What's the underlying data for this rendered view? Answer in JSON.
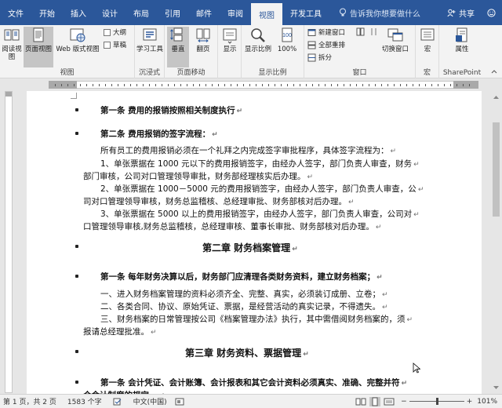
{
  "tabs": [
    "文件",
    "开始",
    "插入",
    "设计",
    "布局",
    "引用",
    "邮件",
    "审阅",
    "视图",
    "开发工具"
  ],
  "active_tab": "视图",
  "tell_me": "告诉我你想要做什么",
  "share": "共享",
  "ribbon": {
    "views": {
      "read_mode": "阅读视图",
      "print_layout": "页面视图",
      "web_layout": "Web 版式视图",
      "outline": "大纲",
      "draft": "草稿",
      "label": "视图"
    },
    "immersive": {
      "learning_tools": "学习工具",
      "label": "沉浸式"
    },
    "page_movement": {
      "vertical": "垂直",
      "side_to_side": "翻页",
      "label": "页面移动"
    },
    "show": {
      "show": "显示"
    },
    "zoom": {
      "zoom": "显示比例",
      "percent": "100%",
      "label": "显示比例"
    },
    "window": {
      "new_window": "新建窗口",
      "arrange_all": "全部重排",
      "split": "拆分",
      "switch_windows": "切换窗口",
      "label": "窗口"
    },
    "macros": {
      "macros": "宏",
      "label": "宏"
    },
    "sharepoint": {
      "properties": "属性",
      "label": "SharePoint"
    }
  },
  "document": {
    "lines": [
      {
        "text": "第一条  费用的报销按照相关制度执行",
        "bold": true,
        "bullet": true
      },
      {
        "text": "第二条  费用报销的签字流程：",
        "bold": true,
        "bullet": true
      },
      {
        "text": "所有员工的费用报销必须在一个礼拜之内完成签字审批程序，具体签字流程为："
      },
      {
        "text": "1、单张票据在 1000 元以下的费用报销签字，由经办人签字，部门负责人审查，财务"
      },
      {
        "text": "部门审核，公司对口管理领导审批，财务部经理核实后办理。"
      },
      {
        "text": "2、单张票据在 1000－5000 元的费用报销签字，由经办人签字，部门负责人审查，公"
      },
      {
        "text": "司对口管理领导审核，财务总监稽核、总经理审批、财务部核对后办理。"
      },
      {
        "text": "3、单张票据在 5000 以上的费用报销签字，由经办人签字，部门负责人审查，公司对"
      },
      {
        "text": "口管理领导审核,财务总监稽核，总经理审核、董事长审批、财务部核对后办理。"
      },
      {
        "text": "第二章    财务档案管理",
        "bold": true,
        "bullet": true,
        "heading": true
      },
      {
        "text": "第一条  每年财务决算以后，财务部门应清理各类财务资料，建立财务档案；",
        "bold": true,
        "bullet": true
      },
      {
        "text": "一、进入财务档案管理的资料必须齐全、完整、真实，必须装订成册、立卷；"
      },
      {
        "text": "二、各类合同、协议、原始凭证、票据，是经营活动的真实记录，不得遗失。"
      },
      {
        "text": "三、财务档案的日常管理按公司《档案管理办法》执行，其中需借阅财务档案的，须"
      },
      {
        "text": "报请总经理批准。"
      },
      {
        "text": "第三章    财务资料、票据管理",
        "bold": true,
        "bullet": true,
        "heading": true
      },
      {
        "text": "第一条  会计凭证、会计账簿、会计报表和其它会计资料必须真实、准确、完整并符",
        "bold": true,
        "bullet": true
      },
      {
        "text": "合会计制度的规定。",
        "bold": true
      }
    ]
  },
  "status": {
    "page": "第 1 页，共 2 页",
    "words": "1583 个字",
    "language": "中文(中国)",
    "zoom": "101%"
  }
}
